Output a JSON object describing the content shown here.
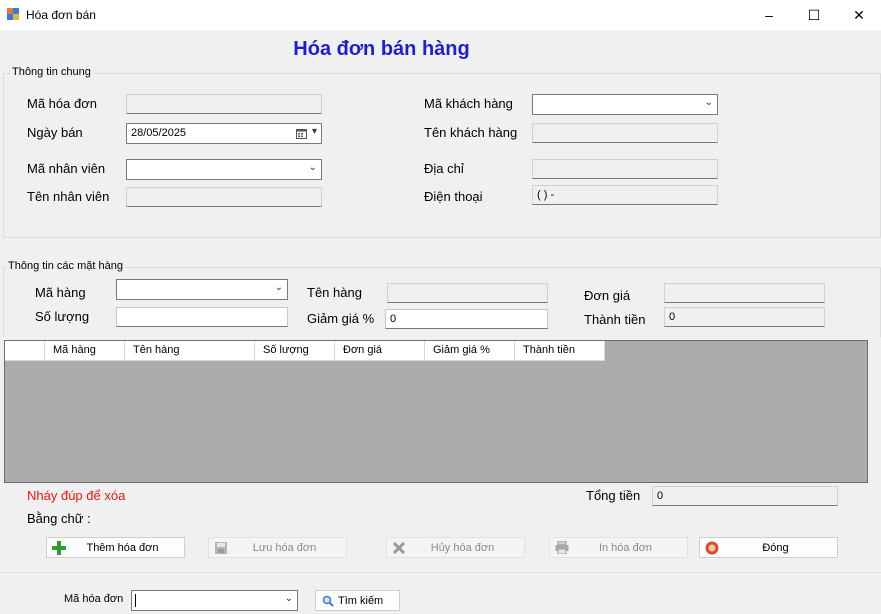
{
  "window": {
    "title": "Hóa đơn bán",
    "minimize": "–",
    "maximize": "☐",
    "close": "✕"
  },
  "heading": "Hóa đơn bán hàng",
  "general": {
    "title": "Thông tin chung",
    "invoice_code_label": "Mã hóa đơn",
    "invoice_code_value": "",
    "sale_date_label": "Ngày bán",
    "sale_date_value": "28/05/2025",
    "employee_code_label": "Mã nhân viên",
    "employee_name_label": "Tên nhân viên",
    "customer_code_label": "Mã khách hàng",
    "customer_name_label": "Tên khách hàng",
    "address_label": "Địa chỉ",
    "phone_label": "Điện thoại",
    "phone_value": "(   )    -"
  },
  "items": {
    "title": "Thông tin các mặt hàng",
    "item_code_label": "Mã hàng",
    "item_name_label": "Tên hàng",
    "unit_price_label": "Đơn giá",
    "quantity_label": "Số lượng",
    "discount_label": "Giảm giá %",
    "discount_value": "0",
    "amount_label": "Thành tiền",
    "amount_value": "0"
  },
  "grid": {
    "columns": [
      "Mã hàng",
      "Tên hàng",
      "Số lượng",
      "Đơn giá",
      "Giảm giá %",
      "Thành tiền"
    ]
  },
  "footer": {
    "hint": "Nháy đúp để xóa",
    "in_words_label": "Bằng chữ :",
    "total_label": "Tổng tiền",
    "total_value": "0"
  },
  "buttons": {
    "add": "Thêm hóa đơn",
    "save": "Lưu hóa đơn",
    "cancel": "Hủy hóa đơn",
    "print": "In hóa đơn",
    "close": "Đóng"
  },
  "search": {
    "label": "Mã hóa đơn",
    "value": "",
    "button": "Tìm kiếm"
  },
  "colors": {
    "heading": "#1f1fcf",
    "hint": "#e8170f",
    "grid_bg": "#ababab"
  }
}
